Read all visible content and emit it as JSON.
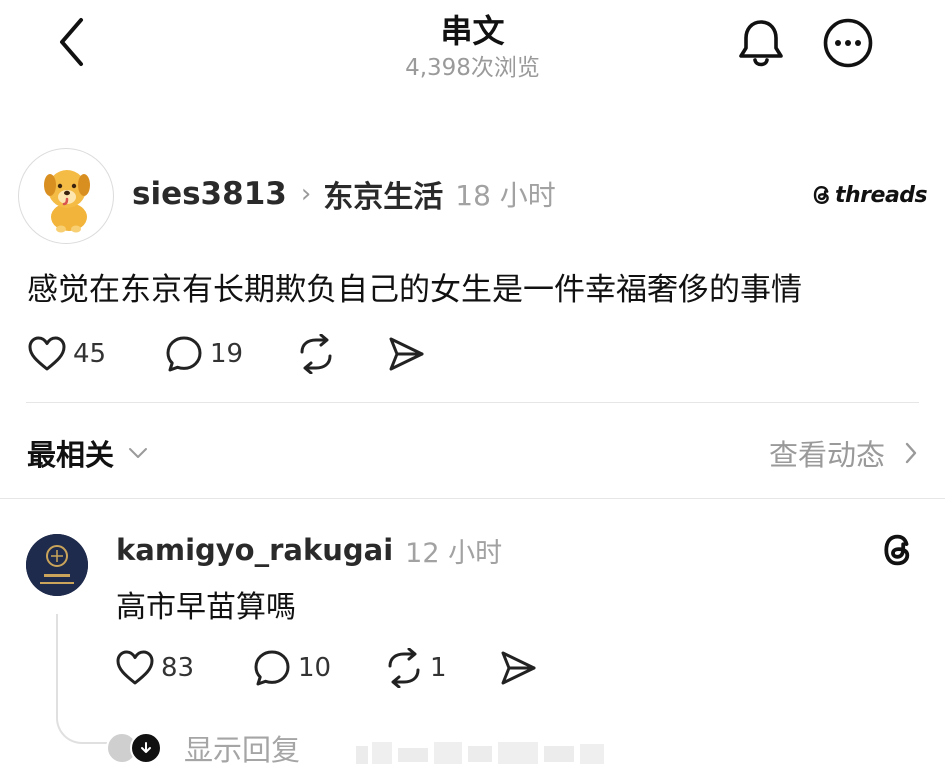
{
  "header": {
    "title": "串文",
    "views": "4,398次浏览"
  },
  "post": {
    "username": "sies3813",
    "topic": "东京生活",
    "time": "18 小时",
    "brand": "threads",
    "text": "感觉在东京有长期欺负自己的女生是一件幸福奢侈的事情",
    "likes": "45",
    "comments": "19"
  },
  "sort": {
    "label": "最相关",
    "activity_label": "查看动态"
  },
  "reply": {
    "username": "kamigyo_rakugai",
    "time": "12 小时",
    "text": "高市早苗算嗎",
    "likes": "83",
    "comments": "10",
    "reposts": "1",
    "show_replies_label": "显示回复"
  },
  "icons": {
    "back": "chevron-left-icon",
    "bell": "bell-icon",
    "more": "more-circle-icon",
    "like": "heart-icon",
    "comment": "comment-icon",
    "repost": "repost-icon",
    "share": "send-icon",
    "threads": "threads-logo-icon"
  },
  "colors": {
    "text": "#111111",
    "muted": "#9a9a9a",
    "divider": "#e6e6e6"
  }
}
